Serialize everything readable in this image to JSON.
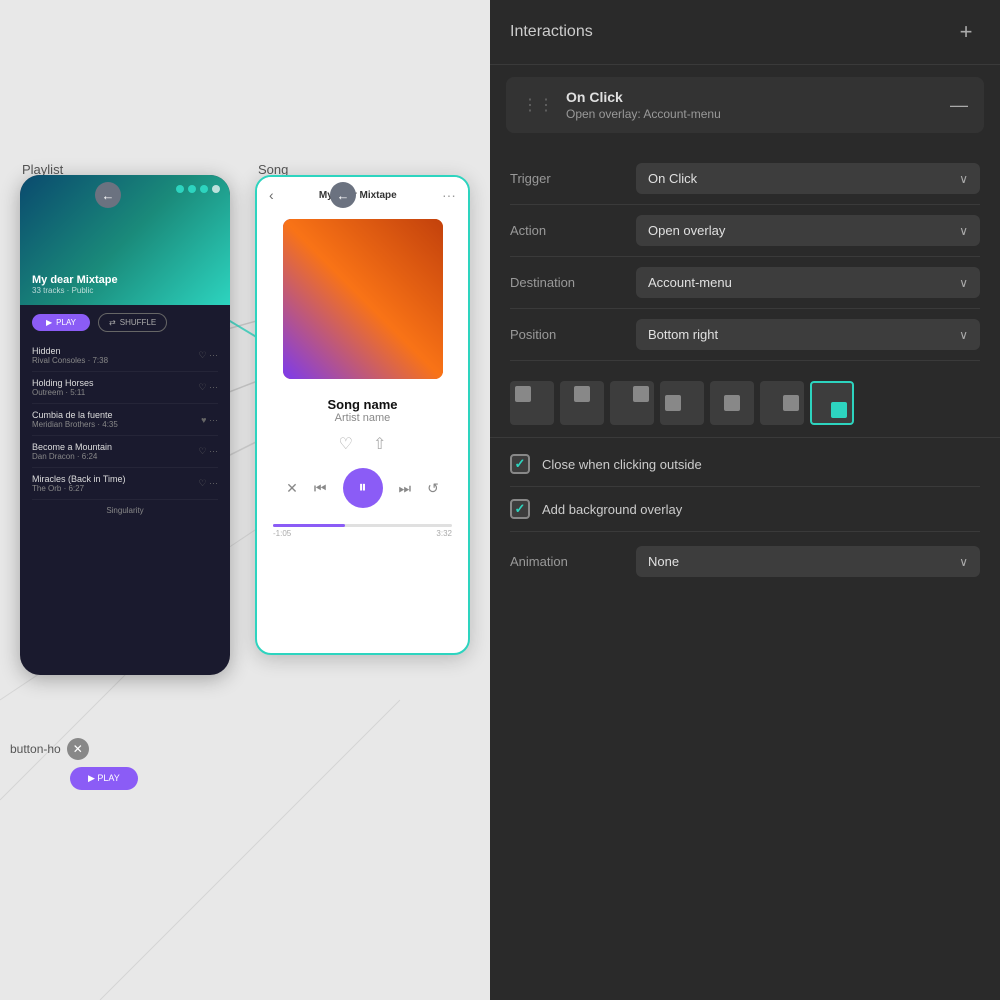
{
  "canvas": {
    "playlist_label": "Playlist",
    "song_label": "Song",
    "playlist": {
      "title": "My dear Mixtape",
      "subtitle": "33 tracks · Public",
      "play_btn": "PLAY",
      "shuffle_btn": "SHUFFLE",
      "tracks": [
        {
          "name": "Hidden",
          "artist": "Rival Consoles · 7:38"
        },
        {
          "name": "Holding Horses",
          "artist": "Outreem · 5:11"
        },
        {
          "name": "Cumbia de la fuente",
          "artist": "Meridian Brothers · 4:35"
        },
        {
          "name": "Become a Mountain",
          "artist": "Dan Dracon · 6:24"
        },
        {
          "name": "Miracles (Back in Time)",
          "artist": "The Orb · 6:27"
        }
      ],
      "footer": "Singularity"
    },
    "song": {
      "header_title": "My dear Mixtape",
      "song_name": "Song name",
      "artist_name": "Artist name",
      "time_current": "-1:05",
      "time_total": "3:32"
    },
    "button_home_label": "button-ho",
    "play_bottom_label": "▶ PLAY"
  },
  "panel": {
    "title": "Interactions",
    "add_btn_label": "+",
    "card": {
      "trigger_label": "On Click",
      "desc_label": "Open overlay: Account-menu"
    },
    "properties": {
      "trigger": {
        "label": "Trigger",
        "value": "On Click"
      },
      "action": {
        "label": "Action",
        "value": "Open overlay"
      },
      "destination": {
        "label": "Destination",
        "value": "Account-menu"
      },
      "position": {
        "label": "Position",
        "value": "Bottom right"
      }
    },
    "position_options": [
      "top-left",
      "top-center",
      "top-right",
      "center-left",
      "center",
      "center-right",
      "bottom-right"
    ],
    "checkboxes": [
      {
        "id": "close-outside",
        "label": "Close when clicking outside",
        "checked": true
      },
      {
        "id": "add-bg-overlay",
        "label": "Add background overlay",
        "checked": true
      }
    ],
    "animation": {
      "label": "Animation",
      "value": "None"
    }
  }
}
